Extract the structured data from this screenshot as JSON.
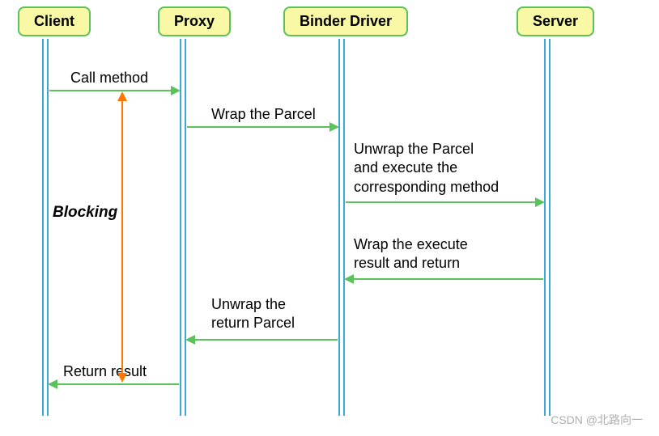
{
  "participants": {
    "client": "Client",
    "proxy": "Proxy",
    "binder": "Binder Driver",
    "server": "Server"
  },
  "messages": {
    "call": "Call method",
    "wrap": "Wrap the Parcel",
    "unwrap_exec_l1": "Unwrap the Parcel",
    "unwrap_exec_l2": "and execute the",
    "unwrap_exec_l3": "corresponding method",
    "wrap_result_l1": "Wrap the execute",
    "wrap_result_l2": "result and return",
    "unwrap_ret_l1": "Unwrap the",
    "unwrap_ret_l2": "return Parcel",
    "return": "Return result"
  },
  "blocking": "Blocking",
  "watermark": "CSDN @北路向一"
}
